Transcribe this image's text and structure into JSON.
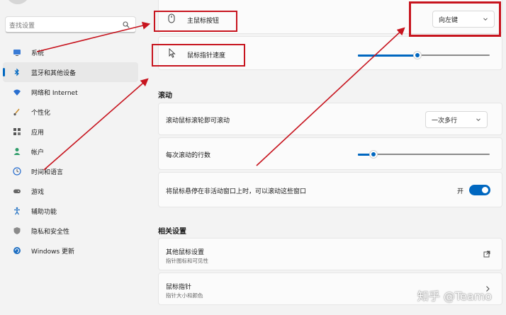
{
  "sidebar": {
    "search_placeholder": "查找设置",
    "items": [
      {
        "label": "系统",
        "icon": "monitor-icon",
        "active": false
      },
      {
        "label": "蓝牙和其他设备",
        "icon": "bluetooth-icon",
        "active": true
      },
      {
        "label": "网络和 Internet",
        "icon": "wifi-icon",
        "active": false
      },
      {
        "label": "个性化",
        "icon": "brush-icon",
        "active": false
      },
      {
        "label": "应用",
        "icon": "apps-icon",
        "active": false
      },
      {
        "label": "帐户",
        "icon": "person-icon",
        "active": false
      },
      {
        "label": "时间和语言",
        "icon": "globe-clock-icon",
        "active": false
      },
      {
        "label": "游戏",
        "icon": "gamepad-icon",
        "active": false
      },
      {
        "label": "辅助功能",
        "icon": "accessibility-icon",
        "active": false
      },
      {
        "label": "隐私和安全性",
        "icon": "shield-icon",
        "active": false
      },
      {
        "label": "Windows 更新",
        "icon": "update-icon",
        "active": false
      }
    ]
  },
  "mouse": {
    "primary_button_label": "主鼠标按钮",
    "primary_button_value": "向左键",
    "pointer_speed_label": "鼠标指针速度",
    "pointer_speed_level": 0.45
  },
  "scroll": {
    "section_title": "滚动",
    "wheel_label": "滚动鼠标滚轮即可滚动",
    "wheel_value": "一次多行",
    "lines_label": "每次滚动的行数",
    "lines_level": 0.12,
    "inactive_label": "将鼠标悬停在非活动窗口上时，可以滚动这些窗口",
    "inactive_state": "开"
  },
  "related": {
    "section_title": "相关设置",
    "other_title": "其他鼠标设置",
    "other_sub": "指针图标和可见性",
    "pointer_title": "鼠标指针",
    "pointer_sub": "指针大小和颜色"
  },
  "watermark": "知乎 @Teamo",
  "colors": {
    "accent": "#0067c0",
    "annotation": "#c7141e"
  }
}
